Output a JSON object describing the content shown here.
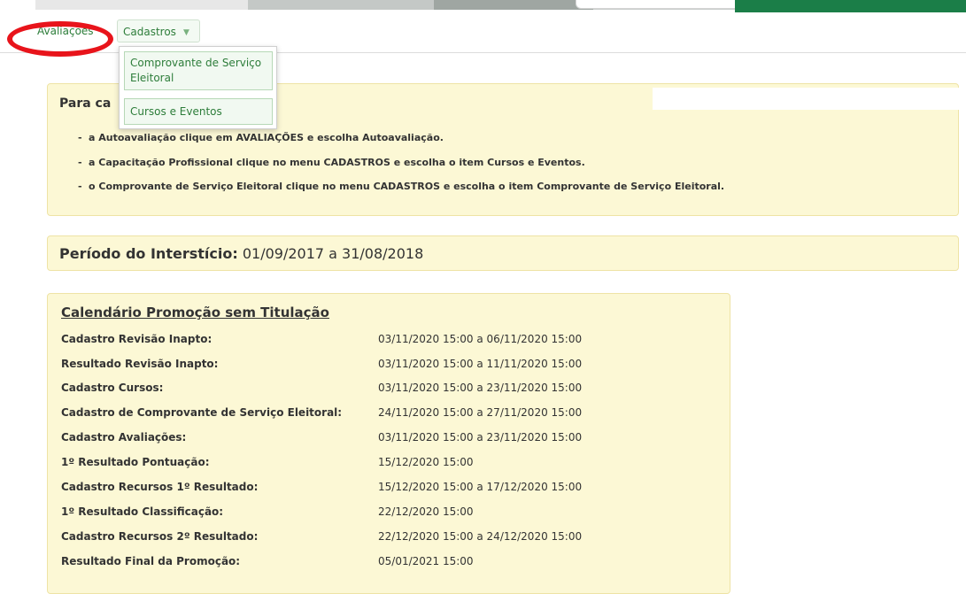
{
  "menu": {
    "items": [
      {
        "label": "Avaliações"
      },
      {
        "label": "Cadastros"
      }
    ],
    "dropdown": [
      {
        "label": "Comprovante de Serviço Eleitoral"
      },
      {
        "label": "Cursos e Eventos"
      }
    ]
  },
  "instructions": {
    "title": "Para ca",
    "items": [
      "a Autoavaliação clique em AVALIAÇÕES e escolha Autoavaliação.",
      "a Capacitação Profissional clique no menu CADASTROS e escolha o item Cursos e Eventos.",
      "o Comprovante de Serviço Eleitoral clique no menu CADASTROS e escolha o item Comprovante de Serviço Eleitoral."
    ]
  },
  "period": {
    "label": "Período do Interstício:",
    "value": "01/09/2017 a 31/08/2018"
  },
  "calendar": {
    "title": "Calendário Promoção sem Titulação",
    "rows": [
      {
        "label": "Cadastro Revisão Inapto:",
        "value": "03/11/2020 15:00 a 06/11/2020 15:00"
      },
      {
        "label": "Resultado Revisão Inapto:",
        "value": "03/11/2020 15:00 a 11/11/2020 15:00"
      },
      {
        "label": "Cadastro Cursos:",
        "value": "03/11/2020 15:00 a 23/11/2020 15:00"
      },
      {
        "label": "Cadastro de Comprovante de Serviço Eleitoral:",
        "value": "24/11/2020 15:00 a 27/11/2020 15:00"
      },
      {
        "label": "Cadastro Avaliações:",
        "value": "03/11/2020 15:00 a 23/11/2020 15:00"
      },
      {
        "label": "1º Resultado Pontuação:",
        "value": "15/12/2020 15:00"
      },
      {
        "label": "Cadastro Recursos 1º Resultado:",
        "value": "15/12/2020 15:00 a 17/12/2020 15:00"
      },
      {
        "label": "1º Resultado Classificação:",
        "value": "22/12/2020 15:00"
      },
      {
        "label": "Cadastro Recursos 2º Resultado:",
        "value": "22/12/2020 15:00 a 24/12/2020 15:00"
      },
      {
        "label": "Resultado Final da Promoção:",
        "value": "05/01/2021 15:00"
      }
    ]
  },
  "colors": {
    "brand_green": "#1b7e48",
    "link_green": "#2d7d3a",
    "panel_bg": "#fcf8d5",
    "annotation_red": "#e8141b"
  },
  "icons": {
    "cadastros_caret": "caret-down-icon"
  }
}
